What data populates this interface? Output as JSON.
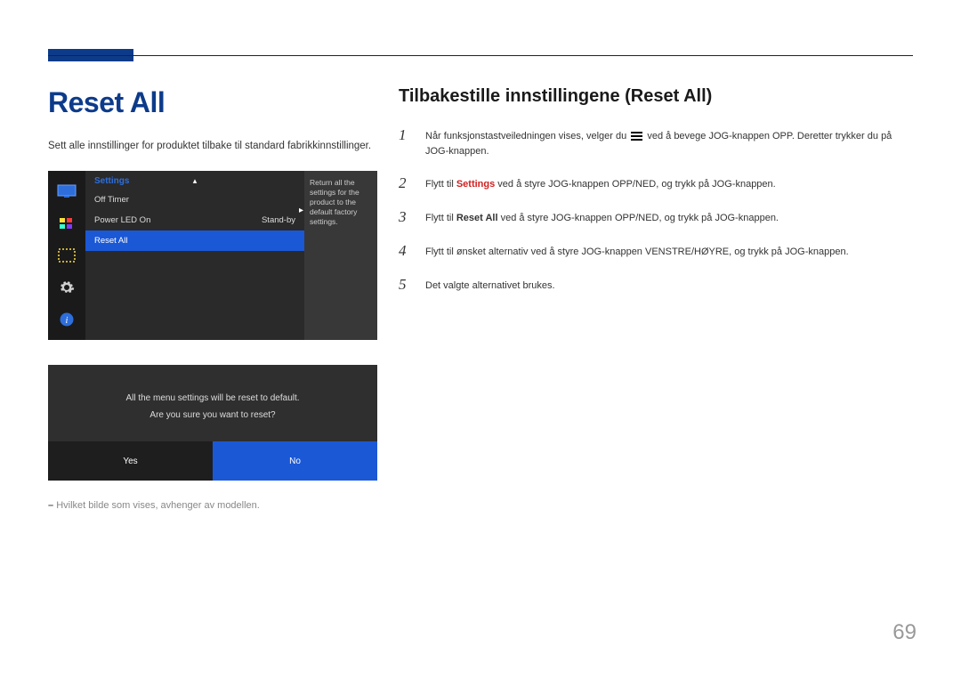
{
  "header": {
    "page_title": "Reset All",
    "intro": "Sett alle innstillinger for produktet tilbake til standard fabrikkinnstillinger."
  },
  "osd": {
    "title": "Settings",
    "rows": [
      {
        "label": "Off Timer",
        "value": ""
      },
      {
        "label": "Power LED On",
        "value": "Stand-by"
      },
      {
        "label": "Reset All",
        "value": ""
      }
    ],
    "description": "Return all the settings for the product to the default factory settings."
  },
  "dialog": {
    "line1": "All the menu settings will be reset to default.",
    "line2": "Are you sure you want to reset?",
    "yes": "Yes",
    "no": "No"
  },
  "footnote": "Hvilket bilde som vises, avhenger av modellen.",
  "right": {
    "title": "Tilbakestille innstillingene (Reset All)",
    "steps": {
      "s1_a": "Når funksjonstastveiledningen vises, velger du ",
      "s1_b": " ved å bevege JOG-knappen OPP. Deretter trykker du på JOG-knappen.",
      "s2_a": "Flytt til ",
      "s2_kw": "Settings",
      "s2_b": " ved å styre JOG-knappen OPP/NED, og trykk på JOG-knappen.",
      "s3_a": "Flytt til ",
      "s3_kw": "Reset All",
      "s3_b": " ved å styre JOG-knappen OPP/NED, og trykk på JOG-knappen.",
      "s4": "Flytt til ønsket alternativ ved å styre JOG-knappen VENSTRE/HØYRE, og trykk på JOG-knappen.",
      "s5": "Det valgte alternativet brukes."
    },
    "nums": {
      "n1": "1",
      "n2": "2",
      "n3": "3",
      "n4": "4",
      "n5": "5"
    }
  },
  "page_number": "69"
}
